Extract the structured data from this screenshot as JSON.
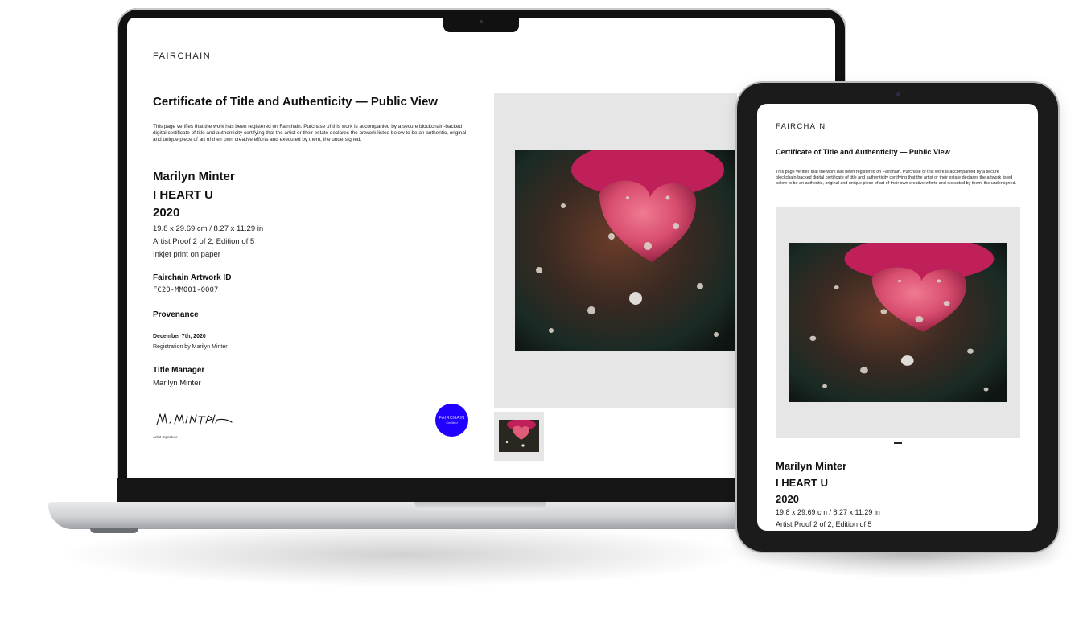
{
  "brand": {
    "logo_text": "FAIRCHAIN"
  },
  "certificate": {
    "title": "Certificate of Title and Authenticity — Public View",
    "intro": "This page verifies that the work has been registered on Fairchain. Purchase of this work is accompanied by a secure blockchain-backed digital certificate of title and authenticity certifying that the artist or their estate declares the artwork listed below to be an authentic, original and unique piece of art of their own creative efforts and executed by them, the undersigned."
  },
  "artwork": {
    "artist": "Marilyn Minter",
    "title": "I HEART U",
    "year": "2020",
    "dimensions": "19.8 x 29.69 cm / 8.27 x 11.29 in",
    "edition": "Artist Proof 2 of 2, Edition of 5",
    "medium": "Inkjet print on paper"
  },
  "artwork_id": {
    "label": "Fairchain Artwork ID",
    "value": "FC20-MM001-0007"
  },
  "provenance": {
    "label": "Provenance",
    "date": "December 7th, 2020",
    "event": "Registration by Marilyn Minter"
  },
  "title_manager": {
    "label": "Title Manager",
    "name": "Marilyn Minter"
  },
  "signature": {
    "label": "Artist Signature"
  },
  "badge": {
    "line1": "FAIRCHAIN",
    "line2": "Certified",
    "color": "#2200ff"
  }
}
